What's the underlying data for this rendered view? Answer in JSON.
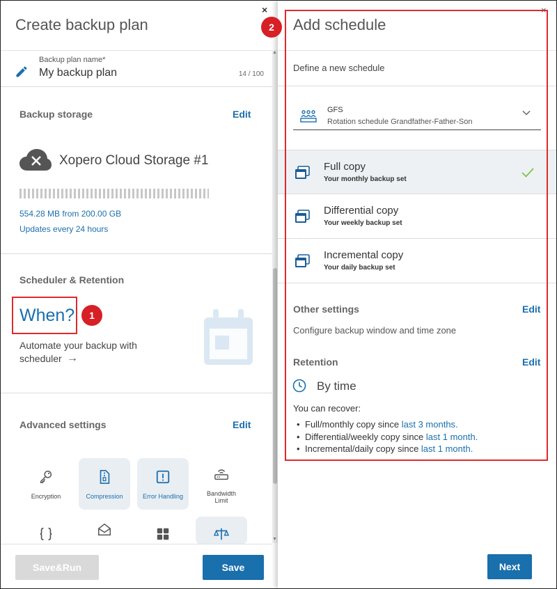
{
  "left_panel": {
    "title": "Create backup plan",
    "close_glyph": "×",
    "plan_name": {
      "label": "Backup plan name*",
      "value": "My backup plan",
      "counter": "14 / 100"
    },
    "storage": {
      "title": "Backup storage",
      "edit": "Edit",
      "name": "Xopero Cloud Storage #1",
      "used": "554.28 MB from 200.00 GB",
      "updates": "Updates every 24 hours"
    },
    "scheduler": {
      "title": "Scheduler & Retention",
      "when": "When?",
      "badge": "1",
      "description": "Automate your backup with scheduler",
      "arrow": "→"
    },
    "advanced": {
      "title": "Advanced settings",
      "edit": "Edit",
      "tiles": [
        {
          "label": "Encryption",
          "icon": "key-icon"
        },
        {
          "label": "Compression",
          "icon": "zip-file-icon"
        },
        {
          "label": "Error Handling",
          "icon": "alert-icon"
        },
        {
          "label": "Bandwidth Limit",
          "icon": "router-icon"
        },
        {
          "label": "",
          "icon": "code-braces-icon"
        },
        {
          "label": "",
          "icon": "mail-open-icon"
        },
        {
          "label": "",
          "icon": "apps-grid-icon"
        },
        {
          "label": "",
          "icon": "balance-scale-icon"
        }
      ]
    },
    "buttons": {
      "save_run": "Save&Run",
      "save": "Save"
    }
  },
  "right_panel": {
    "title": "Add schedule",
    "close_glyph": "×",
    "badge": "2",
    "define": "Define a new schedule",
    "schedule_select": {
      "title": "GFS",
      "subtitle": "Rotation schedule Grandfather-Father-Son"
    },
    "copies": [
      {
        "name": "Full copy",
        "sub": "Your monthly backup set",
        "selected": true
      },
      {
        "name": "Differential copy",
        "sub": "Your weekly backup set",
        "selected": false
      },
      {
        "name": "Incremental copy",
        "sub": "Your daily backup set",
        "selected": false
      }
    ],
    "other_settings": {
      "title": "Other settings",
      "edit": "Edit",
      "description": "Configure backup window and time zone"
    },
    "retention": {
      "title": "Retention",
      "edit": "Edit",
      "mode": "By time",
      "recover_label": "You can recover:",
      "items": [
        {
          "text": "Full/monthly copy since ",
          "link": "last 3 months."
        },
        {
          "text": "Differential/weekly copy since ",
          "link": "last 1 month."
        },
        {
          "text": "Incremental/daily copy since ",
          "link": "last 1 month."
        }
      ]
    },
    "buttons": {
      "next": "Next"
    }
  },
  "colors": {
    "accent": "#1a6fad",
    "annotation_red": "#e0282d",
    "badge_red": "#d71f26",
    "check_green": "#7cc34c"
  }
}
